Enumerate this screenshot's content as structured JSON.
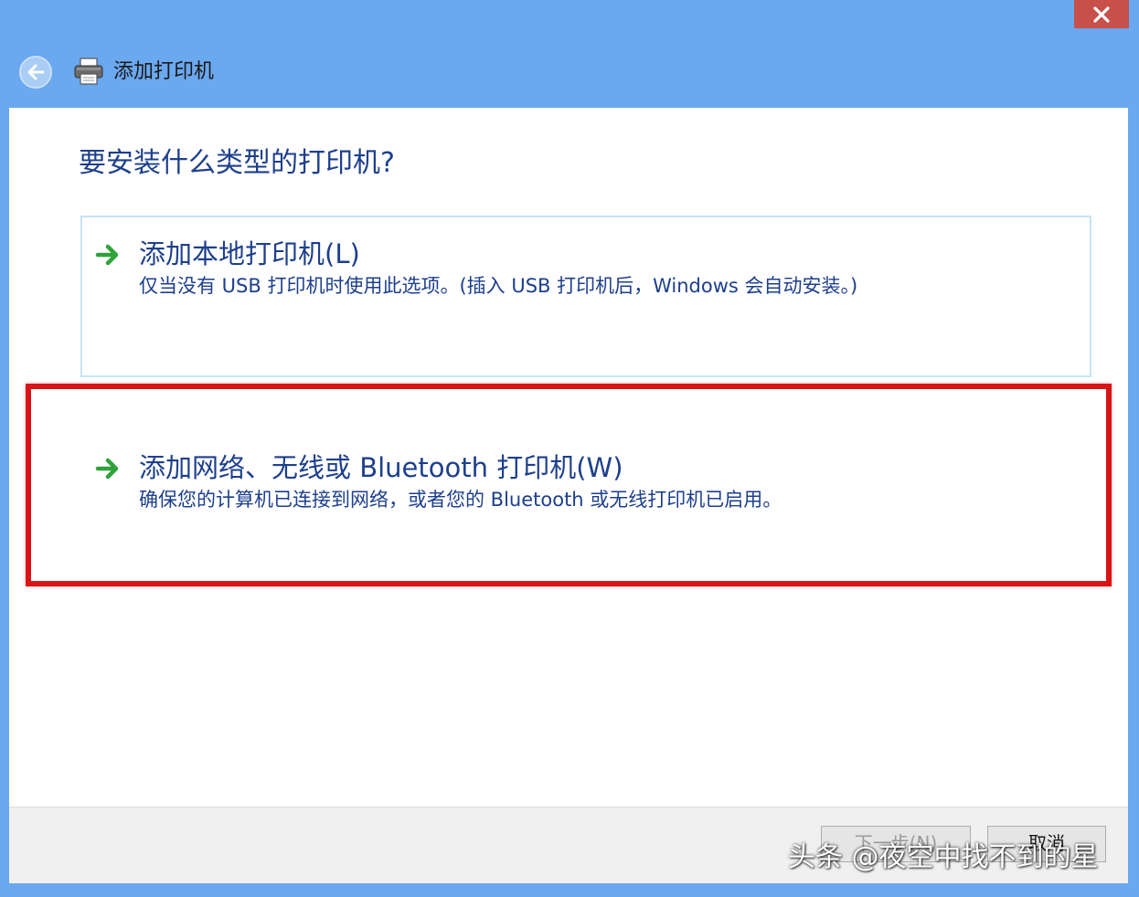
{
  "window": {
    "title": "添加打印机",
    "close_icon": "close-icon",
    "back_icon": "back-arrow-icon",
    "app_icon": "printer-icon"
  },
  "main": {
    "heading": "要安装什么类型的打印机?",
    "options": [
      {
        "title": "添加本地打印机(L)",
        "description": "仅当没有 USB 打印机时使用此选项。(插入 USB 打印机后，Windows 会自动安装。)",
        "icon": "green-arrow-icon"
      },
      {
        "title": "添加网络、无线或 Bluetooth 打印机(W)",
        "description": "确保您的计算机已连接到网络，或者您的 Bluetooth 或无线打印机已启用。",
        "icon": "green-arrow-icon",
        "highlight_color": "#d81416"
      }
    ]
  },
  "footer": {
    "next_label": "下一步(N)",
    "cancel_label": "取消"
  },
  "watermark": "头条 @夜空中找不到的星",
  "colors": {
    "titlebar": "#6aa8ef",
    "text_blue": "#1d3f8c",
    "highlight": "#d81416",
    "arrow_green": "#2fa33a"
  }
}
